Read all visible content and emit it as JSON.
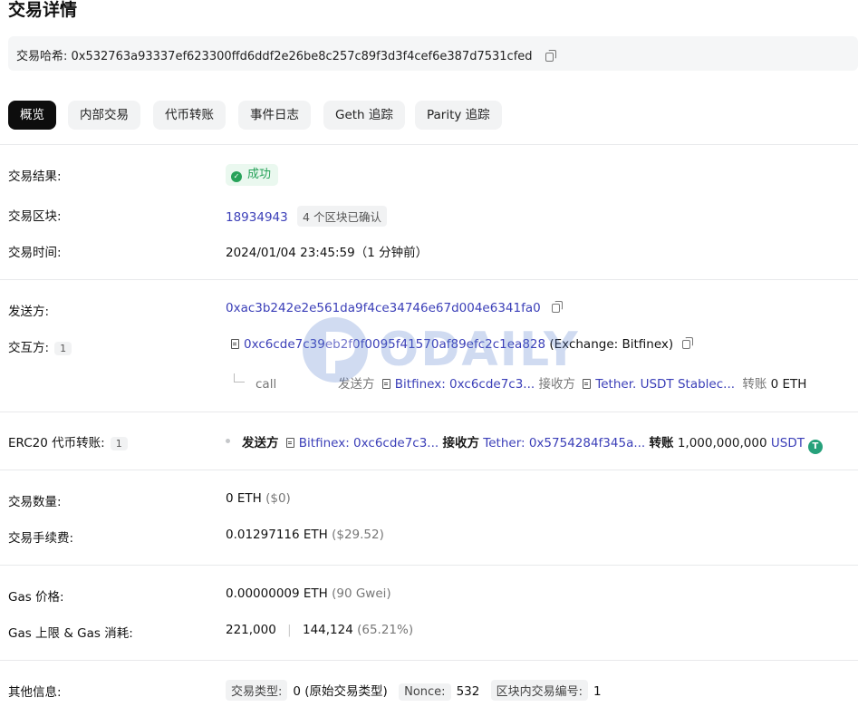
{
  "page": {
    "title": "交易详情"
  },
  "hash": {
    "label": "交易哈希:",
    "value": "0x532763a93337ef623300ffd6ddf2e26be8c257c89f3d3f4cef6e387d7531cfed"
  },
  "tabs": [
    {
      "label": "概览",
      "active": true
    },
    {
      "label": "内部交易"
    },
    {
      "label": "代币转账"
    },
    {
      "label": "事件日志"
    },
    {
      "label": "Geth 追踪"
    },
    {
      "label": "Parity 追踪"
    }
  ],
  "result": {
    "label": "交易结果:",
    "value": "成功"
  },
  "block": {
    "label": "交易区块:",
    "number": "18934943",
    "confirmations": "4 个区块已确认"
  },
  "time": {
    "label": "交易时间:",
    "value": "2024/01/04 23:45:59（1 分钟前）"
  },
  "from": {
    "label": "发送方:",
    "address": "0xac3b242e2e561da9f4ce34746e67d004e6341fa0"
  },
  "interact": {
    "label": "交互方:",
    "count": "1",
    "address": "0xc6cde7c39eb2f0f0095f41570af89efc2c1ea828",
    "tag": "(Exchange: Bitfinex)",
    "call": {
      "type": "call",
      "from_label": "发送方",
      "from_value": "Bitfinex: 0xc6cde7c3...",
      "to_label": "接收方",
      "to_value": "Tether. USDT Stablec...",
      "transfer_label": "转账",
      "transfer_value": "0 ETH"
    }
  },
  "erc20": {
    "label": "ERC20 代币转账:",
    "count": "1",
    "from_label": "发送方",
    "from_value": "Bitfinex: 0xc6cde7c3...",
    "to_label": "接收方",
    "to_value": "Tether: 0x5754284f345a...",
    "transfer_label": "转账",
    "amount": "1,000,000,000",
    "token": "USDT",
    "token_icon": "T"
  },
  "amount": {
    "label": "交易数量:",
    "value": "0 ETH",
    "usd": "($0)"
  },
  "fee": {
    "label": "交易手续费:",
    "value": "0.01297116 ETH",
    "usd": "($29.52)"
  },
  "gas_price": {
    "label": "Gas 价格:",
    "value": "0.00000009 ETH",
    "gwei": "(90 Gwei)"
  },
  "gas_limit": {
    "label": "Gas 上限 & Gas 消耗:",
    "limit": "221,000",
    "sep": "|",
    "used": "144,124",
    "pct": "(65.21%)"
  },
  "other": {
    "label": "其他信息:",
    "type_label": "交易类型:",
    "type_value": "0 (原始交易类型)",
    "nonce_label": "Nonce:",
    "nonce_value": "532",
    "pos_label": "区块内交易编号:",
    "pos_value": "1"
  },
  "watermark": {
    "text": "ODAILY"
  },
  "colors": {
    "link": "#3b3fb8",
    "success": "#27a259",
    "tether": "#26a17b",
    "active_tab": "#0d0d0d"
  }
}
